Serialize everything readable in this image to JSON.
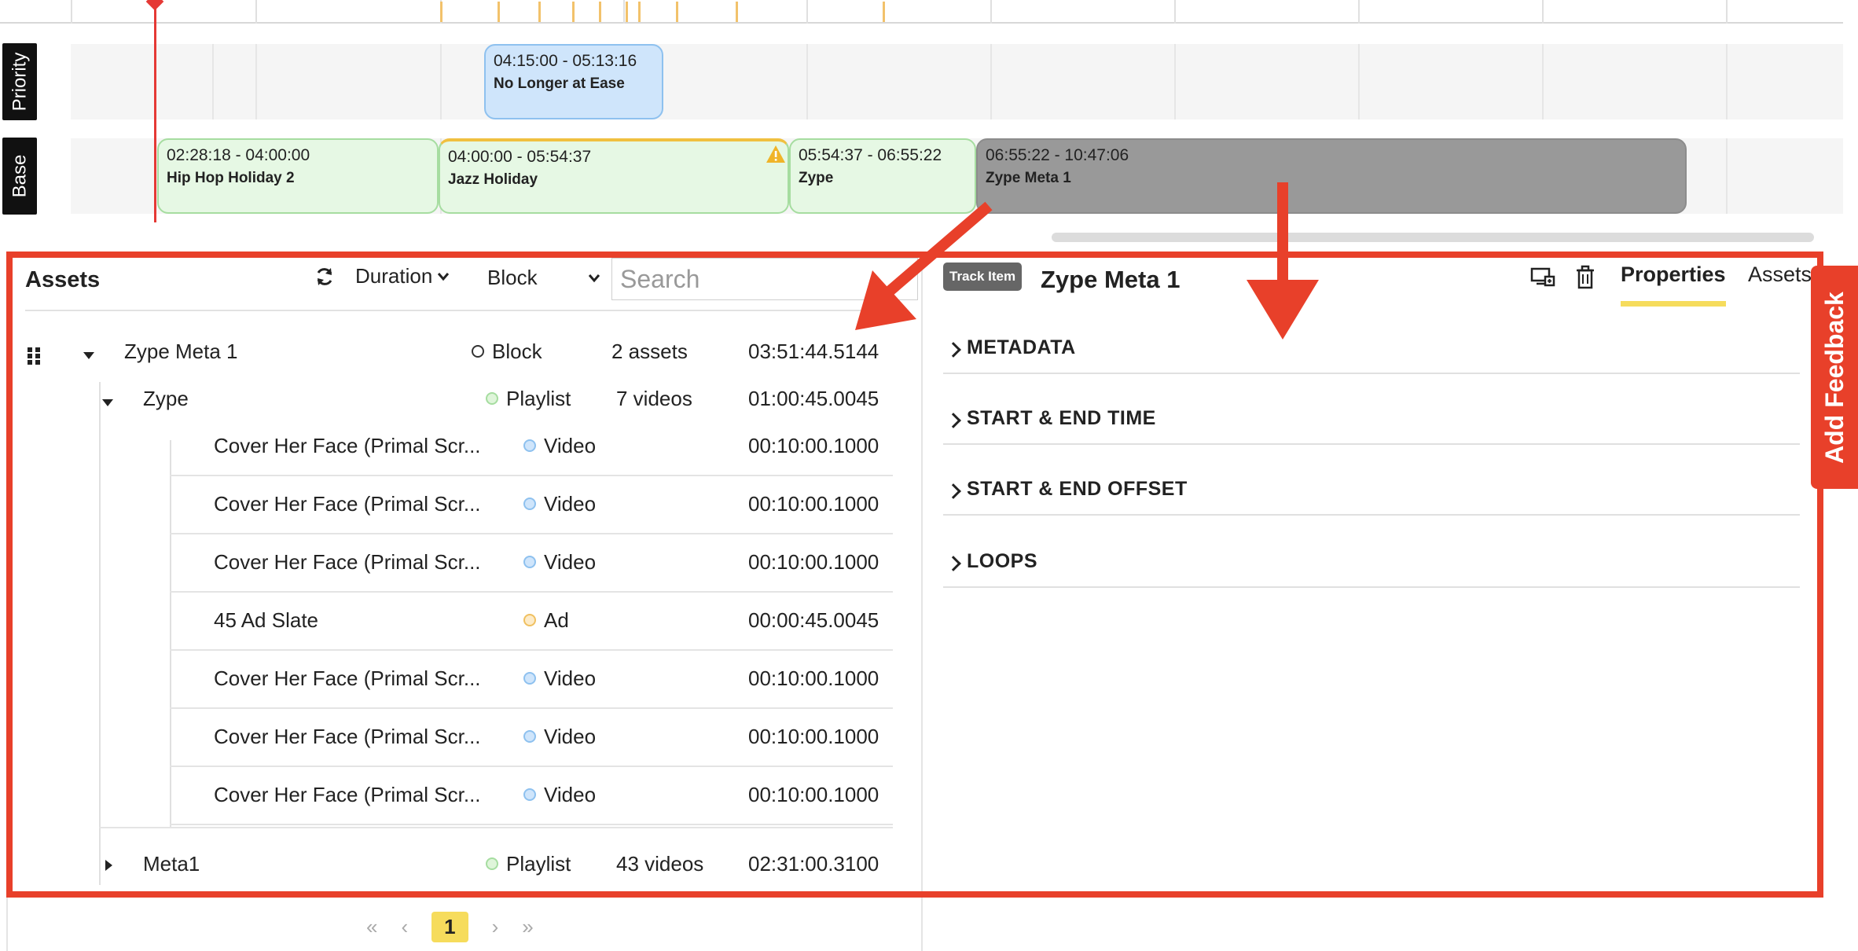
{
  "timeline": {
    "tracks": [
      {
        "id": "priority",
        "label": "Priority"
      },
      {
        "id": "base",
        "label": "Base"
      }
    ],
    "priority_blocks": [
      {
        "time": "04:15:00 - 05:13:16",
        "title": "No Longer at Ease",
        "color": "#cfe5fb"
      }
    ],
    "base_blocks": [
      {
        "time": "02:28:18 - 04:00:00",
        "title": "Hip Hop Holiday 2",
        "color": "#e6f8e4"
      },
      {
        "time": "04:00:00 - 05:54:37",
        "title": "Jazz Holiday",
        "color": "#e6f8e4",
        "warning": true
      },
      {
        "time": "05:54:37 - 06:55:22",
        "title": "Zype",
        "color": "#e6f8e4"
      },
      {
        "time": "06:55:22 - 10:47:06",
        "title": "Zype Meta 1",
        "color": "#999999",
        "selected": true
      }
    ]
  },
  "assets": {
    "title": "Assets",
    "sort_label": "Duration",
    "filter_label": "Block",
    "search_placeholder": "Search",
    "tree": {
      "root": {
        "name": "Zype Meta 1",
        "type": "Block",
        "count": "2 assets",
        "duration": "03:51:44.5144"
      },
      "playlist1": {
        "name": "Zype",
        "type": "Playlist",
        "count": "7 videos",
        "duration": "01:00:45.0045"
      },
      "children": [
        {
          "name": "Cover Her Face (Primal Scr...",
          "type": "Video",
          "duration": "00:10:00.1000"
        },
        {
          "name": "Cover Her Face (Primal Scr...",
          "type": "Video",
          "duration": "00:10:00.1000"
        },
        {
          "name": "Cover Her Face (Primal Scr...",
          "type": "Video",
          "duration": "00:10:00.1000"
        },
        {
          "name": "45 Ad Slate",
          "type": "Ad",
          "duration": "00:00:45.0045"
        },
        {
          "name": "Cover Her Face (Primal Scr...",
          "type": "Video",
          "duration": "00:10:00.1000"
        },
        {
          "name": "Cover Her Face (Primal Scr...",
          "type": "Video",
          "duration": "00:10:00.1000"
        },
        {
          "name": "Cover Her Face (Primal Scr...",
          "type": "Video",
          "duration": "00:10:00.1000"
        }
      ],
      "playlist2": {
        "name": "Meta1",
        "type": "Playlist",
        "count": "43 videos",
        "duration": "02:31:00.3100"
      }
    },
    "pager": {
      "first": "«",
      "prev": "‹",
      "current": "1",
      "next": "›",
      "last": "»"
    }
  },
  "properties": {
    "badge": "Track Item",
    "title": "Zype Meta 1",
    "tabs": [
      "Properties",
      "Assets"
    ],
    "sections": [
      "METADATA",
      "START & END TIME",
      "START & END OFFSET",
      "LOOPS"
    ]
  },
  "feedback": {
    "label": "Add Feedback"
  },
  "colors": {
    "annotation_red": "#e8402a",
    "active_tab_yellow": "#f6dc5c",
    "playhead_red": "#e53935"
  }
}
